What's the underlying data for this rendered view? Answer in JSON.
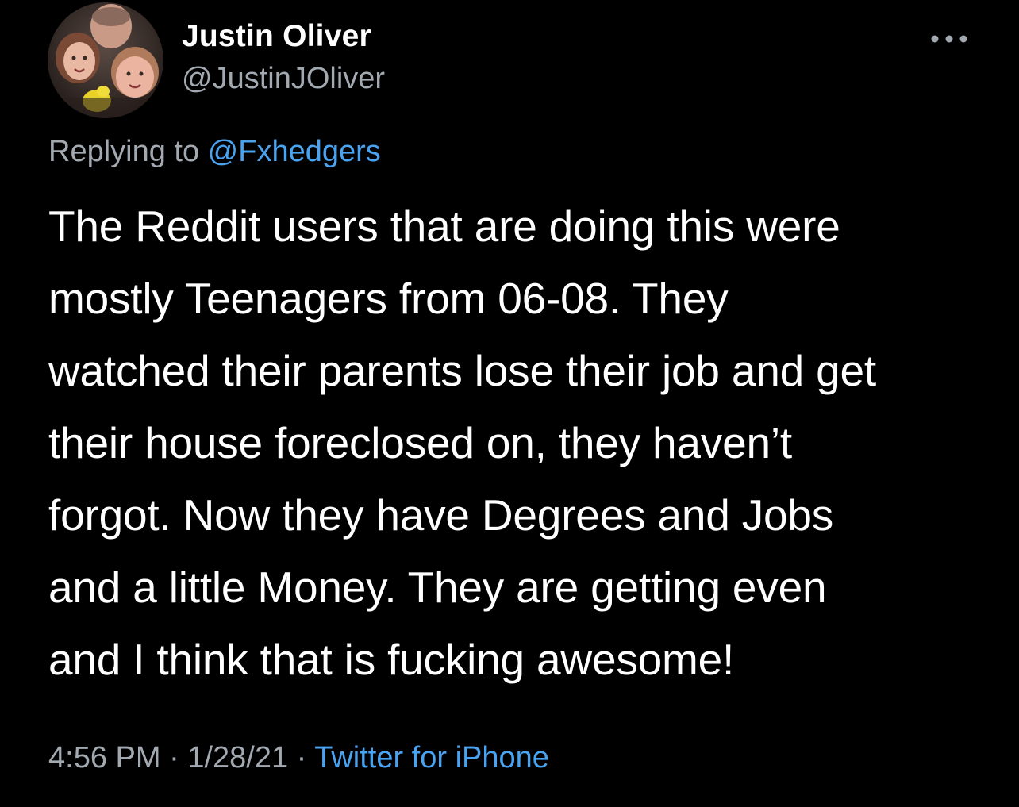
{
  "user": {
    "display_name": "Justin Oliver",
    "handle": "@JustinJOliver",
    "avatar_icon": "profile-photo"
  },
  "reply": {
    "prefix": "Replying to ",
    "mention": "@Fxhedgers"
  },
  "tweet": {
    "lines": [
      "The Reddit users that are doing this were",
      "mostly Teenagers from 06-08. They",
      "watched their parents lose their job and get",
      "their house foreclosed on, they haven’t",
      "forgot. Now they have Degrees and Jobs",
      "and a little Money. They are getting even",
      "and I think that is fucking awesome!"
    ]
  },
  "meta": {
    "time": "4:56 PM",
    "separator1": " · ",
    "date": "1/28/21",
    "separator2": " · ",
    "source": "Twitter for iPhone"
  },
  "menu": {
    "icon": "more-dots-icon"
  },
  "colors": {
    "background": "#000000",
    "text": "#ffffff",
    "secondary": "#a2a9b0",
    "link": "#4aa3f0"
  }
}
